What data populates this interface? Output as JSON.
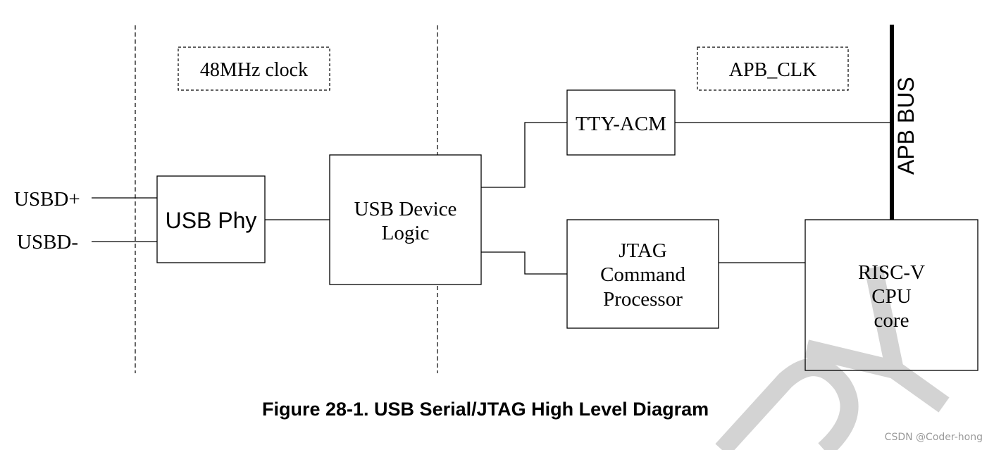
{
  "diagram": {
    "caption": "Figure 28-1. USB Serial/JTAG High Level Diagram",
    "clock_domains": {
      "usb_clock": "48MHz clock",
      "apb_clock": "APB_CLK"
    },
    "signals": {
      "usbd_plus": "USBD+",
      "usbd_minus": "USBD-"
    },
    "blocks": {
      "usb_phy": "USB Phy",
      "usb_device_logic": [
        "USB Device",
        "Logic"
      ],
      "tty_acm": "TTY-ACM",
      "jtag_command_processor": [
        "JTAG",
        "Command",
        "Processor"
      ],
      "riscv_cpu_core": [
        "RISC-V",
        "CPU",
        "core"
      ]
    },
    "bus_label": "APB BUS",
    "watermark_letters": "RY",
    "credit": "CSDN @Coder-hong",
    "colors": {
      "line": "#000000",
      "watermark": "#d3d3d3",
      "credit": "#9a9a9a"
    }
  }
}
